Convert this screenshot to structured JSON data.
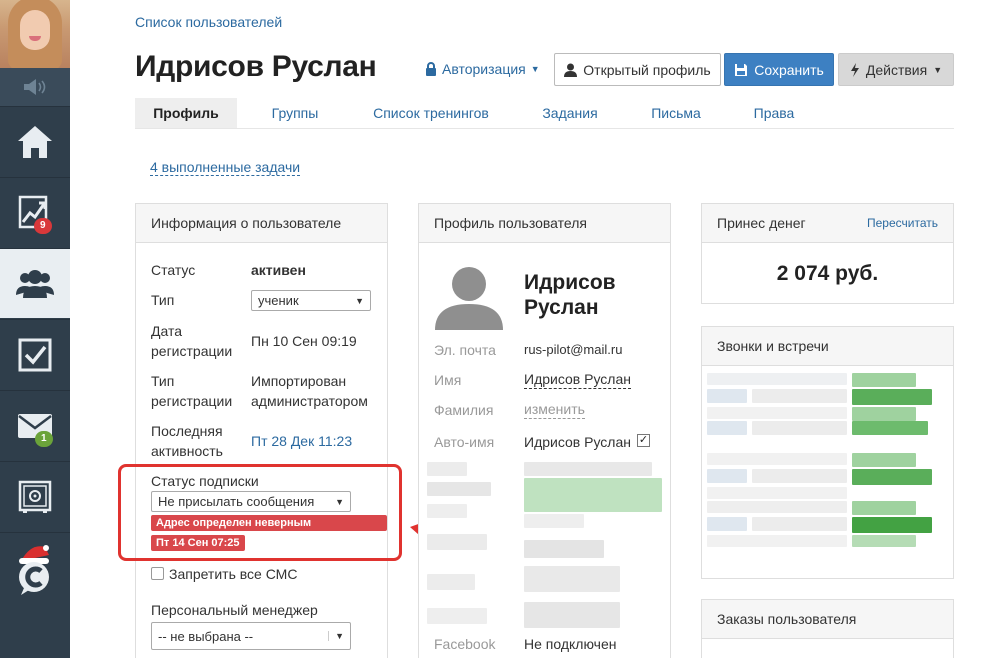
{
  "breadcrumb": "Список пользователей",
  "page_title": "Идрисов Руслан",
  "header": {
    "auth_label": "Авторизация",
    "open_profile_label": "Открытый профиль",
    "save_label": "Сохранить",
    "actions_label": "Действия"
  },
  "tabs": [
    {
      "label": "Профиль",
      "active": true
    },
    {
      "label": "Группы"
    },
    {
      "label": "Список тренингов"
    },
    {
      "label": "Задания"
    },
    {
      "label": "Письма"
    },
    {
      "label": "Права"
    }
  ],
  "tasks_link": "4 выполненные задачи",
  "sidebar": {
    "badges": {
      "stats": "9",
      "mail": "1"
    }
  },
  "user_info": {
    "title": "Информация о пользователе",
    "status_label": "Статус",
    "status_value": "активен",
    "type_label": "Тип",
    "type_value": "ученик",
    "reg_label_1": "Дата",
    "reg_label_2": "регистрации",
    "reg_value": "Пн 10 Сен 09:19",
    "type2_label_1": "Тип",
    "type2_label_2": "регистрации",
    "type2_value_1": "Импортирован",
    "type2_value_2": "администратором",
    "last_label_1": "Последняя",
    "last_label_2": "активность",
    "last_value": "Пт 28 Дек 11:23",
    "sub_label": "Статус подписки",
    "sub_value": "Не присылать сообщения",
    "sub_tag_1": "Адрес определен неверным автоматически",
    "sub_tag_2": "Пт 14 Сен 07:25",
    "sms_label": "Запретить все СМС",
    "manager_label": "Персональный менеджер",
    "manager_value": "-- не выбрана --"
  },
  "profile": {
    "title": "Профиль пользователя",
    "name_1": "Идрисов",
    "name_2": "Руслан",
    "email_label": "Эл. почта",
    "email_value": "rus-pilot@mail.ru",
    "first_label": "Имя",
    "first_value": "Идрисов Руслан",
    "last_label": "Фамилия",
    "last_value": "изменить",
    "auto_label": "Авто-имя",
    "auto_value": "Идрисов Руслан",
    "fb_label": "Facebook",
    "fb_value": "Не подключен"
  },
  "money": {
    "title": "Принес денег",
    "recalc": "Пересчитать",
    "amount": "2 074 руб."
  },
  "calls": {
    "title": "Звонки и встречи"
  },
  "orders": {
    "title": "Заказы пользователя"
  },
  "colors": {
    "sidebar": "#2f3e4b",
    "link": "#2c6aa0",
    "save": "#3d80c2",
    "highlight": "#e0332f",
    "tag": "#d9474b"
  }
}
